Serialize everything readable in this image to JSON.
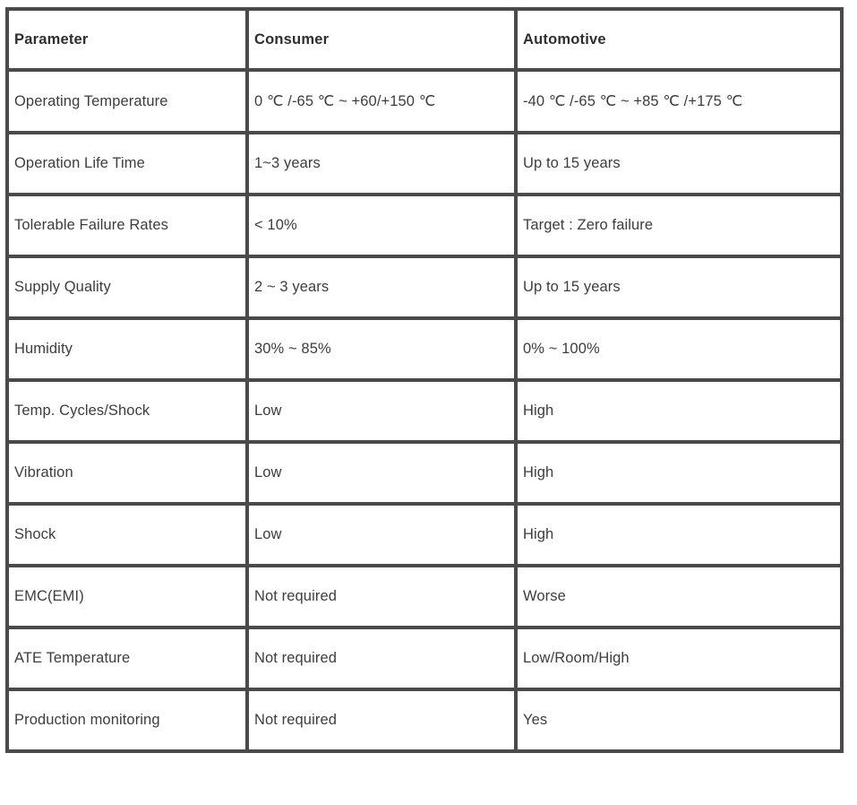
{
  "table": {
    "columns": [
      "Parameter",
      "Consumer",
      "Automotive"
    ],
    "rows": [
      {
        "parameter": "Operating Temperature",
        "consumer": "0 ℃ /-65 ℃ ~ +60/+150 ℃",
        "automotive": "-40 ℃ /-65 ℃ ~ +85 ℃ /+175 ℃"
      },
      {
        "parameter": "Operation Life Time",
        "consumer": "1~3 years",
        "automotive": "Up to 15 years"
      },
      {
        "parameter": "Tolerable Failure Rates",
        "consumer": "< 10%",
        "automotive": "Target : Zero failure"
      },
      {
        "parameter": "Supply Quality",
        "consumer": "2 ~ 3 years",
        "automotive": "Up to 15 years"
      },
      {
        "parameter": "Humidity",
        "consumer": "30% ~ 85%",
        "automotive": "0% ~ 100%"
      },
      {
        "parameter": "Temp. Cycles/Shock",
        "consumer": "Low",
        "automotive": "High"
      },
      {
        "parameter": "Vibration",
        "consumer": "Low",
        "automotive": "High"
      },
      {
        "parameter": "Shock",
        "consumer": "Low",
        "automotive": "High"
      },
      {
        "parameter": "EMC(EMI)",
        "consumer": "Not required",
        "automotive": "Worse"
      },
      {
        "parameter": "ATE Temperature",
        "consumer": "Not required",
        "automotive": "Low/Room/High"
      },
      {
        "parameter": "Production monitoring",
        "consumer": "Not required",
        "automotive": "Yes"
      }
    ]
  },
  "style": {
    "border_color": "#4a4a4a",
    "text_color": "#3d3d3d",
    "header_text_color": "#2e2e2e",
    "background_color": "#ffffff"
  }
}
